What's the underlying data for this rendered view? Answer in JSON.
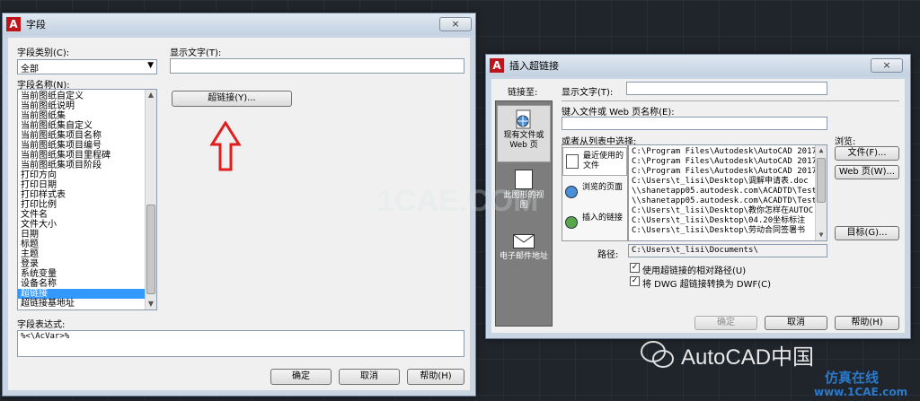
{
  "field_dialog": {
    "title": "字段",
    "close": "×",
    "category_label": "字段类别(C):",
    "category_value": "全部",
    "field_names_label": "字段名称(N):",
    "field_names": [
      "当前图纸自定义",
      "当前图纸说明",
      "当前图纸集",
      "当前图纸集自定义",
      "当前图纸集项目名称",
      "当前图纸集项目编号",
      "当前图纸集项目里程碑",
      "当前图纸集项目阶段",
      "打印方向",
      "打印日期",
      "打印样式表",
      "打印比例",
      "文件名",
      "文件大小",
      "日期",
      "标题",
      "主题",
      "登录",
      "系统变量",
      "设备名称",
      "超链接",
      "超链接基地址"
    ],
    "selected_field": "超链接",
    "display_text_label": "显示文字(T):",
    "display_text_value": "",
    "hyperlink_button": "超链接(Y)...",
    "expression_label": "字段表达式:",
    "expression_value": "%<\\AcVar>%",
    "ok": "确定",
    "cancel": "取消",
    "help": "帮助(H)"
  },
  "hyperlink_dialog": {
    "title": "插入超链接",
    "close": "×",
    "link_to_label": "链接至:",
    "nav": [
      {
        "label": "现有文件或 Web 页",
        "icon": "globe-file-icon"
      },
      {
        "label": "此图形的视图",
        "icon": "drawing-view-icon"
      },
      {
        "label": "电子邮件地址",
        "icon": "email-icon"
      }
    ],
    "display_text_label": "显示文字(T):",
    "display_text_value": "",
    "url_label": "键入文件或 Web 页名称(E):",
    "url_value": "",
    "pick_label": "或者从列表中选择:",
    "browse_label": "浏览:",
    "file_button": "文件(F)...",
    "web_button": "Web 页(W)...",
    "target_button": "目标(G)...",
    "source_tabs": [
      {
        "label": "最近使用的文件",
        "icon": "recent-files-icon"
      },
      {
        "label": "浏览的页面",
        "icon": "browsed-pages-icon"
      },
      {
        "label": "插入的链接",
        "icon": "inserted-links-icon"
      }
    ],
    "recent_files": [
      "C:\\Program Files\\Autodesk\\AutoCAD 2017\\",
      "C:\\Program Files\\Autodesk\\AutoCAD 2017\\",
      "C:\\Program Files\\Autodesk\\AutoCAD 2017\\",
      "C:\\Users\\t_lisi\\Desktop\\调解申请表.doc",
      "\\\\shanetapp05.autodesk.com\\ACADTD\\Test_",
      "\\\\shanetapp05.autodesk.com\\ACADTD\\Test_",
      "C:\\Users\\t_lisi\\Desktop\\教你怎样在AUTOC",
      "C:\\Users\\t_lisi\\Desktop\\04.20坐标标注",
      "C:\\Users\\t_lisi\\Desktop\\劳动合同签署书"
    ],
    "path_label": "路径:",
    "path_value": "C:\\Users\\t_lisi\\Documents\\",
    "relative_path_label": "使用超链接的相对路径(U)",
    "convert_dwf_label": "将 DWG 超链接转换为 DWF(C)",
    "ok": "确定",
    "cancel": "取消",
    "help": "帮助(H)"
  },
  "watermarks": {
    "center": "1CAE.COM",
    "brand": "AutoCAD中国",
    "site_top": "仿真在线",
    "site_bottom": "www.1CAE.com"
  },
  "colors": {
    "arrow": "#e01e1e",
    "selection": "#3399ff",
    "logo": "#c0141b"
  }
}
